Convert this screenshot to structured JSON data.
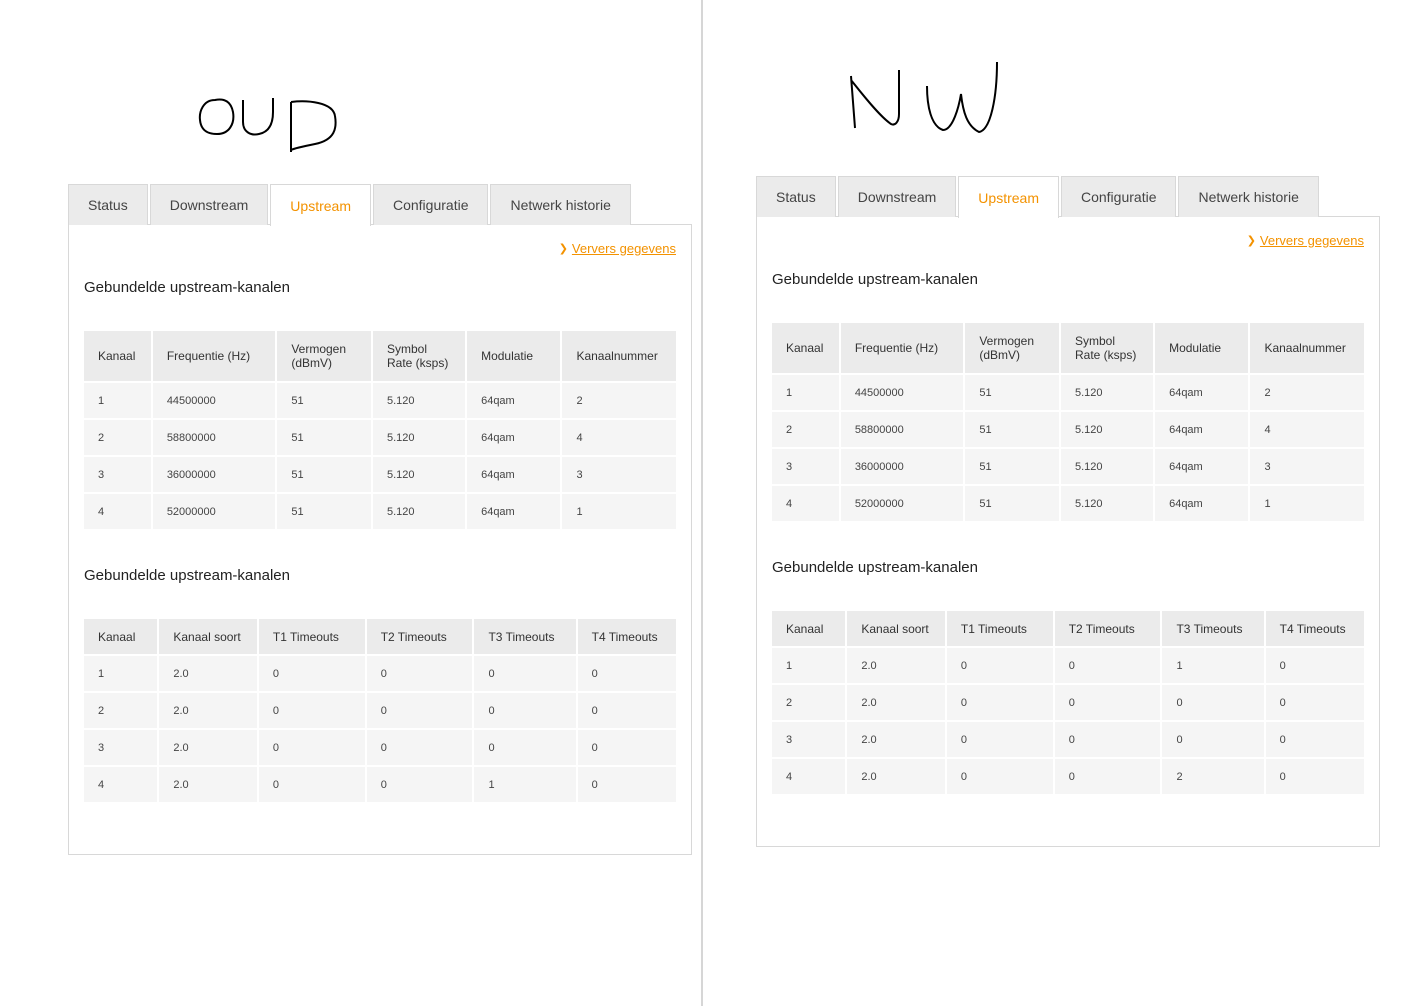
{
  "tabs": [
    "Status",
    "Downstream",
    "Upstream",
    "Configuratie",
    "Netwerk historie"
  ],
  "active_tab": "Upstream",
  "refresh_label": "Ververs gegevens",
  "accent_color": "#f39200",
  "panels": [
    {
      "label": "OUD",
      "table1": {
        "title": "Gebundelde upstream-kanalen",
        "headers": [
          "Kanaal",
          "Frequentie (Hz)",
          "Vermogen (dBmV)",
          "Symbol Rate (ksps)",
          "Modulatie",
          "Kanaalnummer"
        ],
        "rows": [
          [
            "1",
            "44500000",
            "51",
            "5.120",
            "64qam",
            "2"
          ],
          [
            "2",
            "58800000",
            "51",
            "5.120",
            "64qam",
            "4"
          ],
          [
            "3",
            "36000000",
            "51",
            "5.120",
            "64qam",
            "3"
          ],
          [
            "4",
            "52000000",
            "51",
            "5.120",
            "64qam",
            "1"
          ]
        ]
      },
      "table2": {
        "title": "Gebundelde upstream-kanalen",
        "headers": [
          "Kanaal",
          "Kanaal soort",
          "T1 Timeouts",
          "T2 Timeouts",
          "T3 Timeouts",
          "T4 Timeouts"
        ],
        "rows": [
          [
            "1",
            "2.0",
            "0",
            "0",
            "0",
            "0"
          ],
          [
            "2",
            "2.0",
            "0",
            "0",
            "0",
            "0"
          ],
          [
            "3",
            "2.0",
            "0",
            "0",
            "0",
            "0"
          ],
          [
            "4",
            "2.0",
            "0",
            "0",
            "1",
            "0"
          ]
        ]
      }
    },
    {
      "label": "NW",
      "table1": {
        "title": "Gebundelde upstream-kanalen",
        "headers": [
          "Kanaal",
          "Frequentie (Hz)",
          "Vermogen (dBmV)",
          "Symbol Rate (ksps)",
          "Modulatie",
          "Kanaalnummer"
        ],
        "rows": [
          [
            "1",
            "44500000",
            "51",
            "5.120",
            "64qam",
            "2"
          ],
          [
            "2",
            "58800000",
            "51",
            "5.120",
            "64qam",
            "4"
          ],
          [
            "3",
            "36000000",
            "51",
            "5.120",
            "64qam",
            "3"
          ],
          [
            "4",
            "52000000",
            "51",
            "5.120",
            "64qam",
            "1"
          ]
        ]
      },
      "table2": {
        "title": "Gebundelde upstream-kanalen",
        "headers": [
          "Kanaal",
          "Kanaal soort",
          "T1 Timeouts",
          "T2 Timeouts",
          "T3 Timeouts",
          "T4 Timeouts"
        ],
        "rows": [
          [
            "1",
            "2.0",
            "0",
            "0",
            "1",
            "0"
          ],
          [
            "2",
            "2.0",
            "0",
            "0",
            "0",
            "0"
          ],
          [
            "3",
            "2.0",
            "0",
            "0",
            "0",
            "0"
          ],
          [
            "4",
            "2.0",
            "0",
            "0",
            "2",
            "0"
          ]
        ]
      }
    }
  ]
}
